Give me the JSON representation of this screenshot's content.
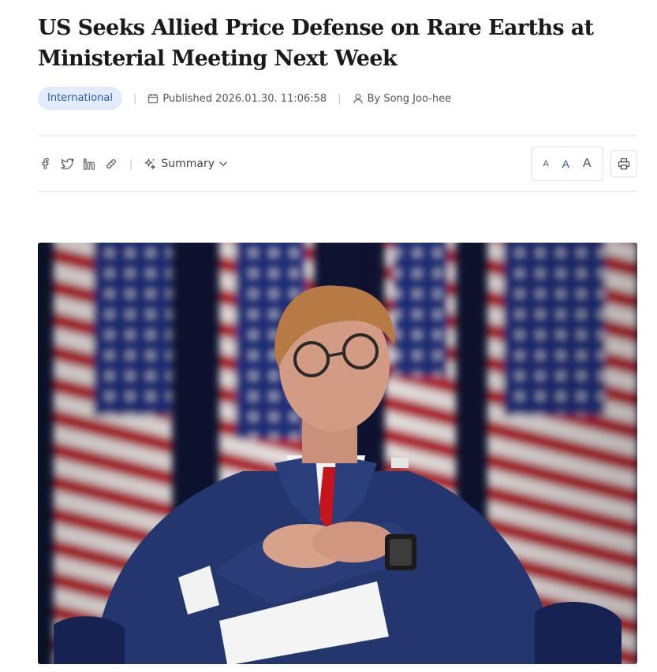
{
  "article": {
    "headline": "US Seeks Allied Price Defense on Rare Earths at Ministerial Meeting Next Week",
    "category": "International",
    "published": "Published 2026.01.30. 11:06:58",
    "author": "By Song Joo-hee"
  },
  "toolbar": {
    "share_icons": [
      "facebook-icon",
      "twitter-icon",
      "linkedin-icon",
      "link-icon"
    ],
    "summary_label": "Summary",
    "font_sizes": [
      "A",
      "A",
      "A"
    ],
    "print_icon": "printer-icon"
  },
  "colors": {
    "accent": "#2b58b8",
    "badge_bg": "#e3ecfb",
    "divider": "#e1e1e1"
  }
}
